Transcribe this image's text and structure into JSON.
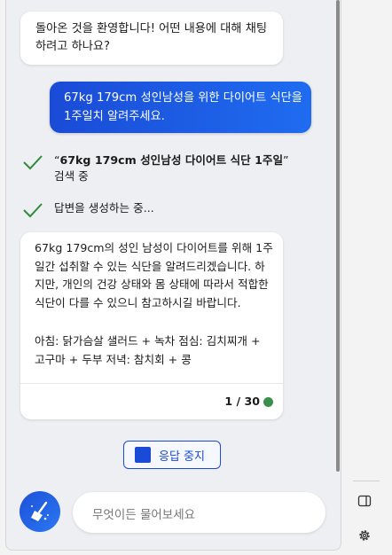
{
  "chat": {
    "greeting": "돌아온 것을 환영합니다! 어떤 내용에 대해 채팅하려고 하나요?",
    "user_message": "67kg 179cm 성인남성을 위한 다이어트 식단을 1주일치 알려주세요.",
    "status_search_prefix": "“",
    "status_search_query_plain": "67kg 179cm ",
    "status_search_query_bold": "성인남성 다이어트 식단 1주일",
    "status_search_suffix": "”",
    "status_search_action": "검색 중",
    "status_generating": "답변을 생성하는 중...",
    "answer_para1": "67kg 179cm의 성인 남성이 다이어트를 위해 1주일간 섭취할 수 있는 식단을 알려드리겠습니다. 하지만, 개인의 건강 상태와 몸 상태에 따라서 적합한 식단이 다를 수 있으니 참고하시길 바랍니다.",
    "answer_para2": "아침: 닭가슴살 샐러드 + 녹차 점심: 김치찌개 + 고구마 + 두부 저녁: 참치회 + 콩",
    "counter": "1 / 30"
  },
  "controls": {
    "stop_label": "응답 중지",
    "input_placeholder": "무엇이든 물어보세요"
  },
  "icons": {
    "check": "check-icon",
    "broom": "broom-icon",
    "panel": "panel-icon",
    "settings": "gear-icon",
    "stop": "stop-icon"
  },
  "colors": {
    "accent": "#1a4bd6",
    "check": "#2e8b3a",
    "status_dot": "#3a8f4c"
  }
}
